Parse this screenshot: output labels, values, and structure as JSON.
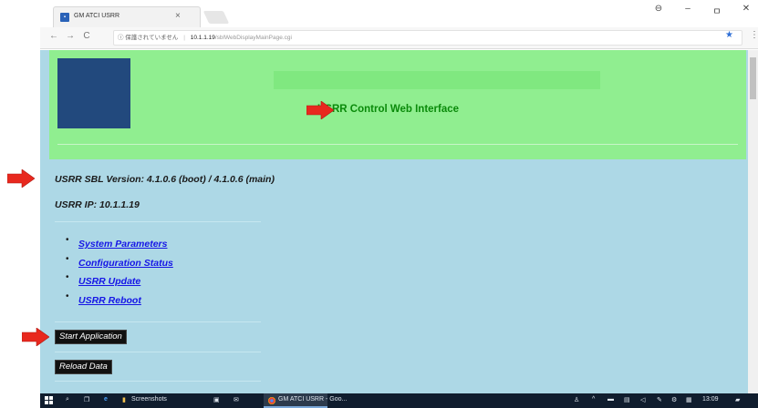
{
  "browser": {
    "tab_title": "GM ATCI USRR",
    "tab_close": "×",
    "window_controls": [
      "⊖",
      "–",
      "ㅁ",
      "✕"
    ],
    "nav": {
      "back": "←",
      "forward": "→",
      "reload": "C"
    },
    "address": {
      "security_text": "ⓘ 保護されていません",
      "host": "10.1.1.19",
      "path": "/sblWebDisplayMainPage.cgi"
    },
    "bookmark_icon": "★",
    "menu_icon": "⋮"
  },
  "page": {
    "header_title": "USRR Control Web Interface",
    "version_line": "USRR SBL Version: 4.1.0.6 (boot) / 4.1.0.6 (main)",
    "ip_line": "USRR IP: 10.1.1.19",
    "menu_links": [
      "System Parameters",
      "Configuration Status",
      "USRR Update",
      "USRR Reboot"
    ],
    "buttons": {
      "start_application": "Start Application",
      "reload_data": "Reload Data"
    }
  },
  "taskbar": {
    "folder_label": "Screenshots",
    "browser_label": "GM ATCI USRR - Goo...",
    "clock": "13:09"
  },
  "colors": {
    "header_bg": "#90ee90",
    "page_bg": "#add8e6",
    "title_green": "#0a8a0a",
    "link_blue": "#1515e6",
    "logo_navy": "#22497d",
    "annotation_red": "#e8281e"
  }
}
